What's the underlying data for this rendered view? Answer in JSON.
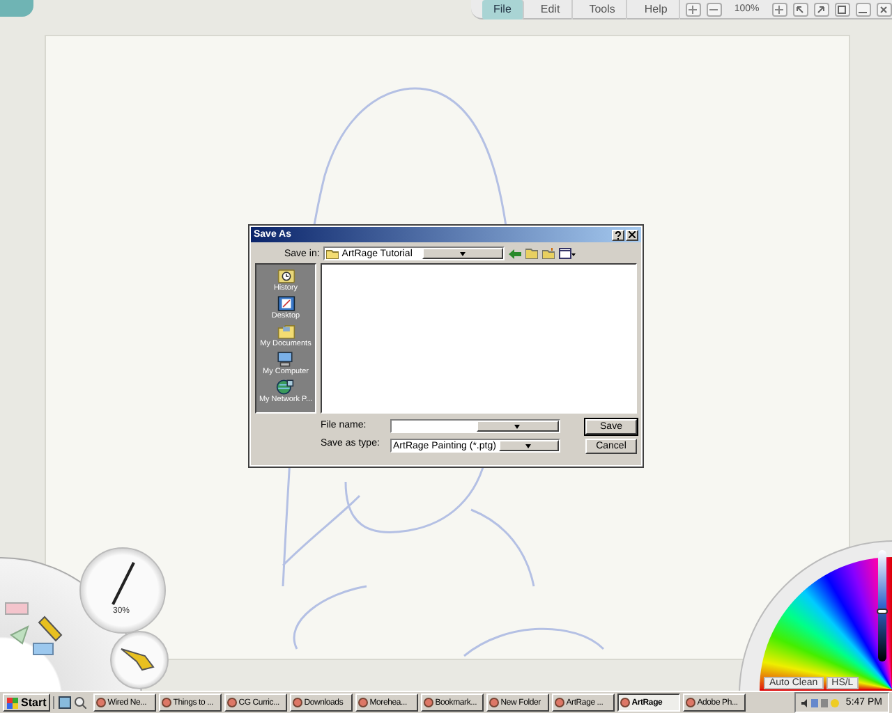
{
  "menu_bar": {
    "items": [
      {
        "label": "File",
        "selected": true
      },
      {
        "label": "Edit",
        "selected": false
      },
      {
        "label": "Tools",
        "selected": false
      },
      {
        "label": "Help",
        "selected": false
      }
    ],
    "zoom": "100%"
  },
  "dialog": {
    "title": "Save As",
    "save_in": {
      "label": "Save in:",
      "value": "ArtRage Tutorial"
    },
    "places": [
      {
        "label": "History",
        "kind": "history"
      },
      {
        "label": "Desktop",
        "kind": "desktop"
      },
      {
        "label": "My Documents",
        "kind": "documents"
      },
      {
        "label": "My Computer",
        "kind": "computer"
      },
      {
        "label": "My Network P...",
        "kind": "network"
      }
    ],
    "file_name": {
      "label": "File name:"
    },
    "save_type": {
      "label": "Save as type:",
      "value": "ArtRage Painting (*.ptg)"
    },
    "buttons": [
      "Save",
      "Cancel"
    ]
  },
  "tool_pod": {
    "size": "30%"
  },
  "color_pod": {
    "auto_clean": "Auto Clean",
    "mode": "HS/L",
    "level": 0.45
  },
  "taskbar": {
    "start": "Start",
    "tasks": [
      {
        "label": "Wired Ne...",
        "selected": false
      },
      {
        "label": "Things to ...",
        "selected": false
      },
      {
        "label": "CG Curric...",
        "selected": false
      },
      {
        "label": "Downloads",
        "selected": false
      },
      {
        "label": "Morehea...",
        "selected": false
      },
      {
        "label": "Bookmark...",
        "selected": false
      },
      {
        "label": "New Folder",
        "selected": false
      },
      {
        "label": "ArtRage ...",
        "selected": false
      },
      {
        "label": "ArtRage",
        "selected": true
      },
      {
        "label": "Adobe Ph...",
        "selected": false
      }
    ],
    "clock": "5:47 PM"
  }
}
